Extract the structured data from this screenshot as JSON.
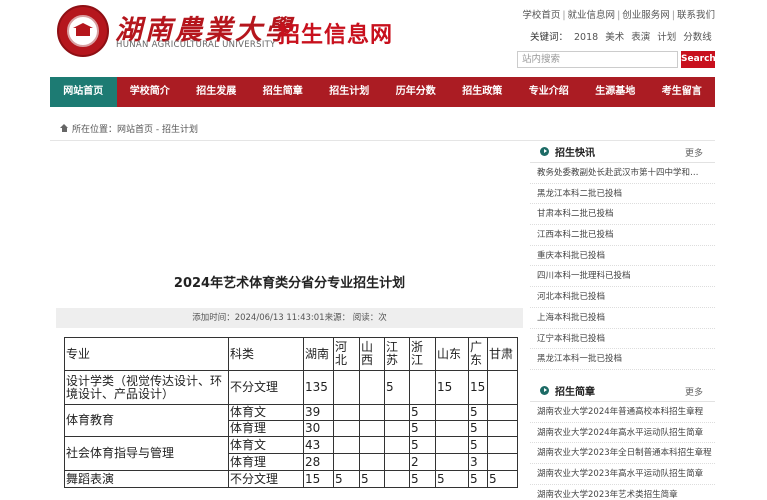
{
  "header": {
    "school_cn": "湖南農業大學",
    "school_en": "HUNAN AGRICULTURAL UNIVERSITY",
    "site_title": "招生信息网",
    "top_links": [
      "学校首页",
      "就业信息网",
      "创业服务网",
      "联系我们"
    ],
    "hotwords_label": "关键词：",
    "hotwords": [
      "2018",
      "美术",
      "表演",
      "计划",
      "分数线"
    ],
    "search_placeholder": "站内搜索",
    "search_button": "Search"
  },
  "nav": [
    "网站首页",
    "学校简介",
    "招生发展",
    "招生简章",
    "招生计划",
    "历年分数",
    "招生政策",
    "专业介绍",
    "生源基地",
    "考生留言"
  ],
  "breadcrumb": {
    "prefix": "所在位置：",
    "path": "网站首页 - 招生计划"
  },
  "article": {
    "title": "2024年艺术体育类分省分专业招生计划",
    "meta": "添加时间：2024/06/13 11:43:01来源：  阅读：次"
  },
  "table": {
    "headers": [
      "专业",
      "科类",
      "湖南",
      "河北",
      "山西",
      "江苏",
      "浙江",
      "山东",
      "广东",
      "甘肃"
    ],
    "rows": [
      {
        "major": "设计学类（视觉传达设计、环境设计、产品设计）",
        "cat": "不分文理",
        "v": [
          "135",
          "",
          "",
          "5",
          "",
          "15",
          "15",
          ""
        ]
      },
      {
        "major": "体育教育",
        "cat": "体育文",
        "v": [
          "39",
          "",
          "",
          "",
          "5",
          "",
          "5",
          ""
        ]
      },
      {
        "major": "",
        "cat": "体育理",
        "v": [
          "30",
          "",
          "",
          "",
          "5",
          "",
          "5",
          ""
        ]
      },
      {
        "major": "社会体育指导与管理",
        "cat": "体育文",
        "v": [
          "43",
          "",
          "",
          "",
          "5",
          "",
          "5",
          ""
        ]
      },
      {
        "major": "",
        "cat": "体育理",
        "v": [
          "28",
          "",
          "",
          "",
          "2",
          "",
          "3",
          ""
        ]
      },
      {
        "major": "舞蹈表演",
        "cat": "不分文理",
        "v": [
          "15",
          "5",
          "5",
          "",
          "5",
          "5",
          "5",
          "5"
        ]
      }
    ]
  },
  "sidebar": {
    "news": {
      "title": "招生快讯",
      "more": "更多",
      "items": [
        "教务处委教副处长赴武汉市第十四中学和…",
        "黑龙江本科二批已投档",
        "甘肃本科二批已投档",
        "江西本科二批已投档",
        "重庆本科批已投档",
        "四川本科一批理科已投档",
        "河北本科批已投档",
        "上海本科批已投档",
        "辽宁本科批已投档",
        "黑龙江本科一批已投档"
      ]
    },
    "brochure": {
      "title": "招生简章",
      "more": "更多",
      "items": [
        "湖南农业大学2024年普通高校本科招生章程",
        "湖南农业大学2024年高水平运动队招生简章",
        "湖南农业大学2023年全日制普通本科招生章程",
        "湖南农业大学2023年高水平运动队招生简章",
        "湖南农业大学2023年艺术类招生简章"
      ]
    }
  }
}
